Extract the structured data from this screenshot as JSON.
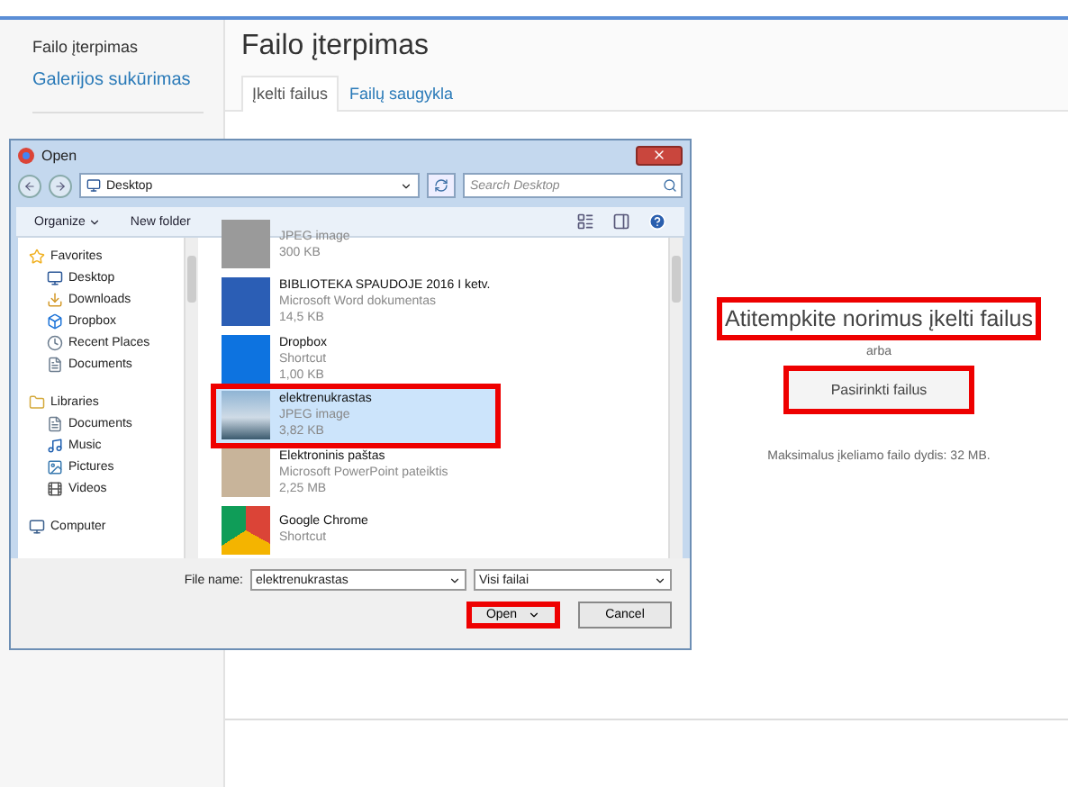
{
  "sidebar": {
    "items": [
      {
        "label": "Failo įterpimas",
        "selected": true
      },
      {
        "label": "Galerijos sukūrimas",
        "selected": false
      }
    ]
  },
  "header": {
    "title": "Failo įterpimas",
    "tabs": [
      {
        "label": "Įkelti failus",
        "selected": true
      },
      {
        "label": "Failų saugykla",
        "selected": false
      }
    ]
  },
  "upload": {
    "drop_text": "Atitempkite norimus įkelti failus",
    "drop_highlighted": true,
    "or_text": "arba",
    "button": "Pasirinkti failus",
    "button_highlighted": true,
    "limit_text": "Maksimalus įkeliamo failo dydis: 32 MB."
  },
  "dialog": {
    "title": "Open",
    "location": "Desktop",
    "search": {
      "placeholder": "Search Desktop"
    },
    "toolbar": [
      "Organize",
      "New folder"
    ],
    "nav": [
      {
        "label": "Favorites",
        "kind": "star",
        "children": [
          {
            "label": "Desktop",
            "kind": "desktop"
          },
          {
            "label": "Downloads",
            "kind": "downloads"
          },
          {
            "label": "Dropbox",
            "kind": "dropbox"
          },
          {
            "label": "Recent Places",
            "kind": "recent"
          },
          {
            "label": "Documents",
            "kind": "documents"
          }
        ]
      },
      {
        "label": "Libraries",
        "kind": "library",
        "children": [
          {
            "label": "Documents",
            "kind": "documents"
          },
          {
            "label": "Music",
            "kind": "music"
          },
          {
            "label": "Pictures",
            "kind": "pictures"
          },
          {
            "label": "Videos",
            "kind": "videos"
          }
        ]
      },
      {
        "label": "Computer",
        "kind": "computer"
      }
    ],
    "files": [
      {
        "kind": "jpeg",
        "type": "JPEG image",
        "size": "300 KB",
        "selected": false,
        "highlighted": false
      },
      {
        "kind": "word",
        "name": "BIBLIOTEKA SPAUDOJE 2016 I ketv.",
        "type": "Microsoft Word dokumentas",
        "size": "14,5 KB",
        "selected": false,
        "highlighted": false
      },
      {
        "kind": "shortcut",
        "name": "Dropbox",
        "type": "Shortcut",
        "size": "1,00 KB",
        "selected": false,
        "highlighted": false
      },
      {
        "kind": "photo",
        "name": "elektrenukrastas",
        "type": "JPEG image",
        "size": "3,82 KB",
        "selected": true,
        "highlighted": true
      },
      {
        "kind": "pptx",
        "name": "Elektroninis paštas",
        "type": "Microsoft PowerPoint pateiktis",
        "size": "2,25 MB",
        "selected": false,
        "highlighted": false
      },
      {
        "kind": "chrome",
        "name": "Google Chrome",
        "type": "Shortcut",
        "selected": false,
        "highlighted": false
      }
    ],
    "file_name_label": "File name:",
    "file_name": "elektrenukrastas",
    "file_type": "Visi failai",
    "open_button": "Open",
    "open_highlighted": true,
    "cancel_button": "Cancel"
  }
}
